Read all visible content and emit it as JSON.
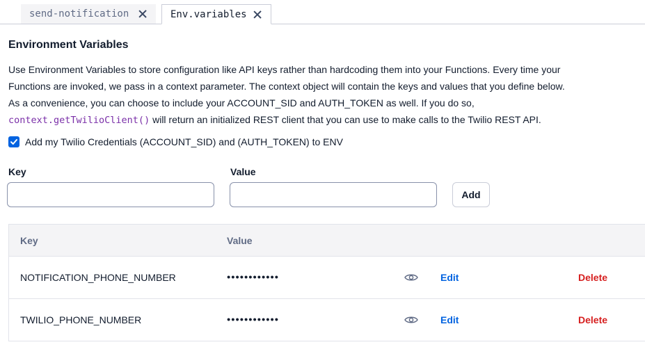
{
  "tabs": [
    {
      "label": "send-notification",
      "active": false
    },
    {
      "label": "Env.variables",
      "active": true
    }
  ],
  "section": {
    "title": "Environment Variables",
    "desc_part1": "Use Environment Variables to store configuration like API keys rather than hardcoding them into your Functions. Every time your Functions are invoked, we pass in a context parameter. The context object will contain the keys and values that you define below. As a convenience, you can choose to include your ACCOUNT_SID and AUTH_TOKEN as well. If you do so, ",
    "desc_code": "context.getTwilioClient()",
    "desc_part2": " will return an initialized REST client that you can use to make calls to the Twilio REST API."
  },
  "credentials": {
    "label": "Add my Twilio Credentials (ACCOUNT_SID) and (AUTH_TOKEN) to ENV",
    "checked": true
  },
  "form": {
    "key_label": "Key",
    "value_label": "Value",
    "key_value": "",
    "value_value": "",
    "add_label": "Add"
  },
  "table": {
    "headers": {
      "key": "Key",
      "value": "Value"
    },
    "rows": [
      {
        "key": "NOTIFICATION_PHONE_NUMBER",
        "value": "••••••••••••",
        "edit": "Edit",
        "delete": "Delete"
      },
      {
        "key": "TWILIO_PHONE_NUMBER",
        "value": "••••••••••••",
        "edit": "Edit",
        "delete": "Delete"
      }
    ]
  },
  "colors": {
    "accent": "#0263e0",
    "danger": "#d61f1f",
    "code": "#7a2fa8"
  }
}
